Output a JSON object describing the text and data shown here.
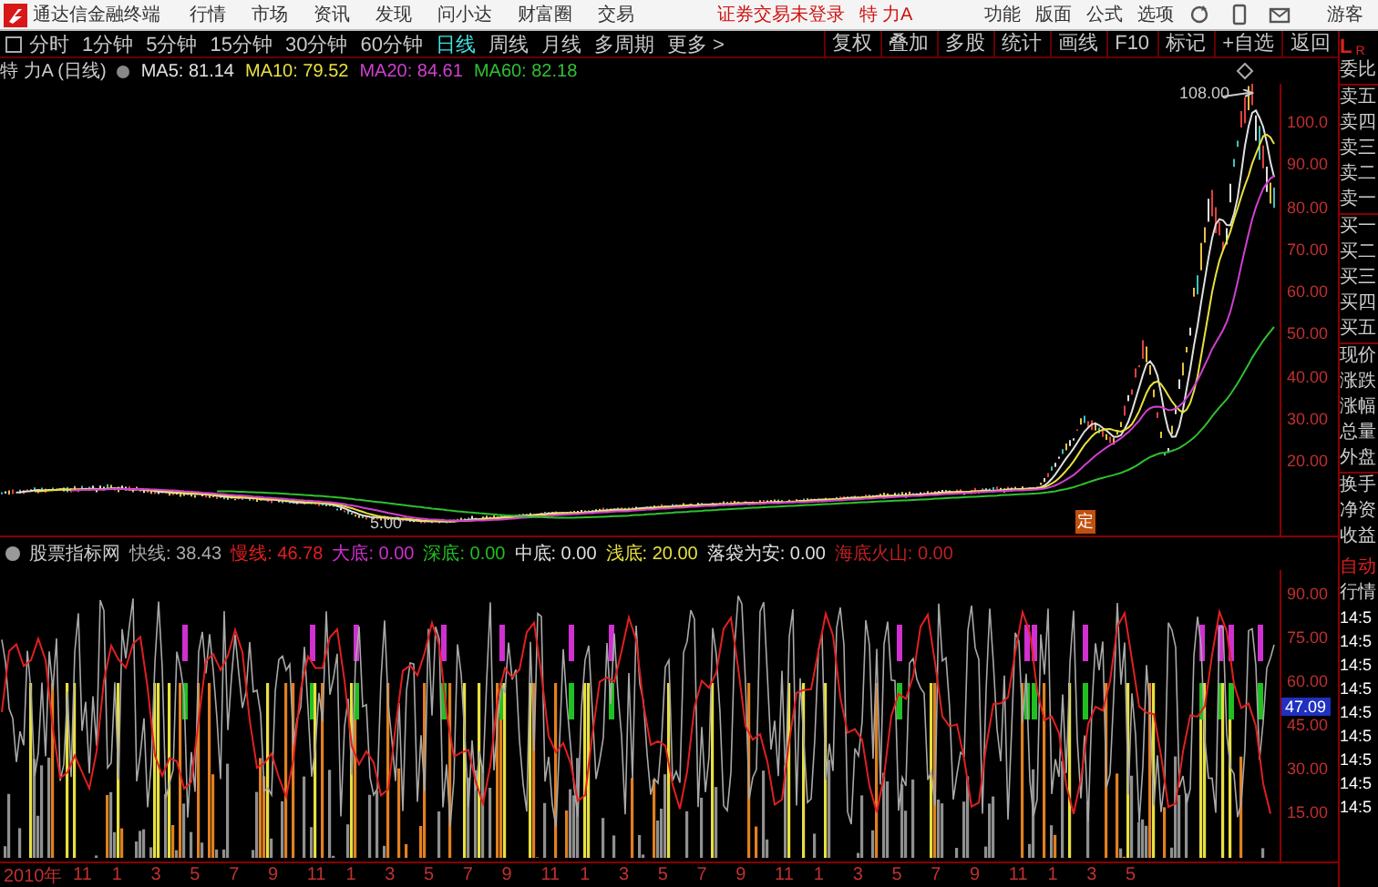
{
  "menubar": {
    "app_title": "通达信金融终端",
    "menus": [
      "行情",
      "市场",
      "资讯",
      "发现",
      "问小达",
      "财富圈",
      "交易"
    ],
    "login_status": "证券交易未登录",
    "stock_name": "特 力A",
    "right_menus": [
      "功能",
      "版面",
      "公式",
      "选项"
    ],
    "user": "游客"
  },
  "period_tabs": [
    {
      "label": "分时",
      "selected": false
    },
    {
      "label": "1分钟",
      "selected": false
    },
    {
      "label": "5分钟",
      "selected": false
    },
    {
      "label": "15分钟",
      "selected": false
    },
    {
      "label": "30分钟",
      "selected": false
    },
    {
      "label": "60分钟",
      "selected": false
    },
    {
      "label": "日线",
      "selected": true
    },
    {
      "label": "周线",
      "selected": false
    },
    {
      "label": "月线",
      "selected": false
    },
    {
      "label": "多周期",
      "selected": false
    },
    {
      "label": "更多 >",
      "selected": false
    }
  ],
  "tool_buttons": [
    "复权",
    "叠加",
    "多股",
    "统计",
    "画线",
    "F10",
    "标记",
    "+自选",
    "返回"
  ],
  "side_panel": {
    "header_l": "L",
    "header_r": "R",
    "quote_labels": [
      "委比",
      "卖五",
      "卖四",
      "卖三",
      "卖二",
      "卖一",
      "买一",
      "买二",
      "买三",
      "买四",
      "买五",
      "现价",
      "涨跌",
      "涨幅",
      "总量",
      "外盘",
      "换手",
      "净资",
      "收益"
    ],
    "lower_labels": [
      "自动",
      "行情"
    ],
    "times": [
      "14:5",
      "14:5",
      "14:5",
      "14:5",
      "14:5",
      "14:5",
      "14:5",
      "14:5",
      "14:5"
    ]
  },
  "price_chart": {
    "title": "特 力A (日线)",
    "ma": [
      {
        "text": "MA5: 81.14",
        "color": "#e0e0e0"
      },
      {
        "text": "MA10: 79.52",
        "color": "#e8e040"
      },
      {
        "text": "MA20: 84.61",
        "color": "#d040d0"
      },
      {
        "text": "MA60: 82.18",
        "color": "#30c030"
      }
    ],
    "y_labels": [
      "100.0",
      "90.00",
      "80.00",
      "70.00",
      "60.00",
      "50.00",
      "40.00",
      "30.00",
      "20.00"
    ],
    "high_annotation": "108.00",
    "low_annotation": "5.00",
    "marker": "定"
  },
  "indicator": {
    "name": "股票指标网",
    "lines": [
      {
        "text": "快线: 38.43",
        "color": "#a8a8a8"
      },
      {
        "text": "慢线: 46.78",
        "color": "#e02020"
      },
      {
        "text": "大底: 0.00",
        "color": "#d030d0"
      },
      {
        "text": "深底: 0.00",
        "color": "#20c020"
      },
      {
        "text": "中底: 0.00",
        "color": "#e0e0e0"
      },
      {
        "text": "浅底: 20.00",
        "color": "#e8e040"
      },
      {
        "text": "落袋为安: 0.00",
        "color": "#e0e0e0"
      },
      {
        "text": "海底火山: 0.00",
        "color": "#c02020"
      }
    ],
    "y_labels": [
      "90.00",
      "75.00",
      "60.00",
      "45.00",
      "30.00",
      "15.00"
    ],
    "current_value": "47.09"
  },
  "date_axis": [
    "2010年",
    "11",
    "1",
    "3",
    "5",
    "7",
    "9",
    "11",
    "1",
    "3",
    "5",
    "7",
    "9",
    "11",
    "1",
    "3",
    "5",
    "7",
    "9",
    "11",
    "1",
    "3",
    "5",
    "7",
    "9",
    "11",
    "1",
    "3",
    "5"
  ]
}
